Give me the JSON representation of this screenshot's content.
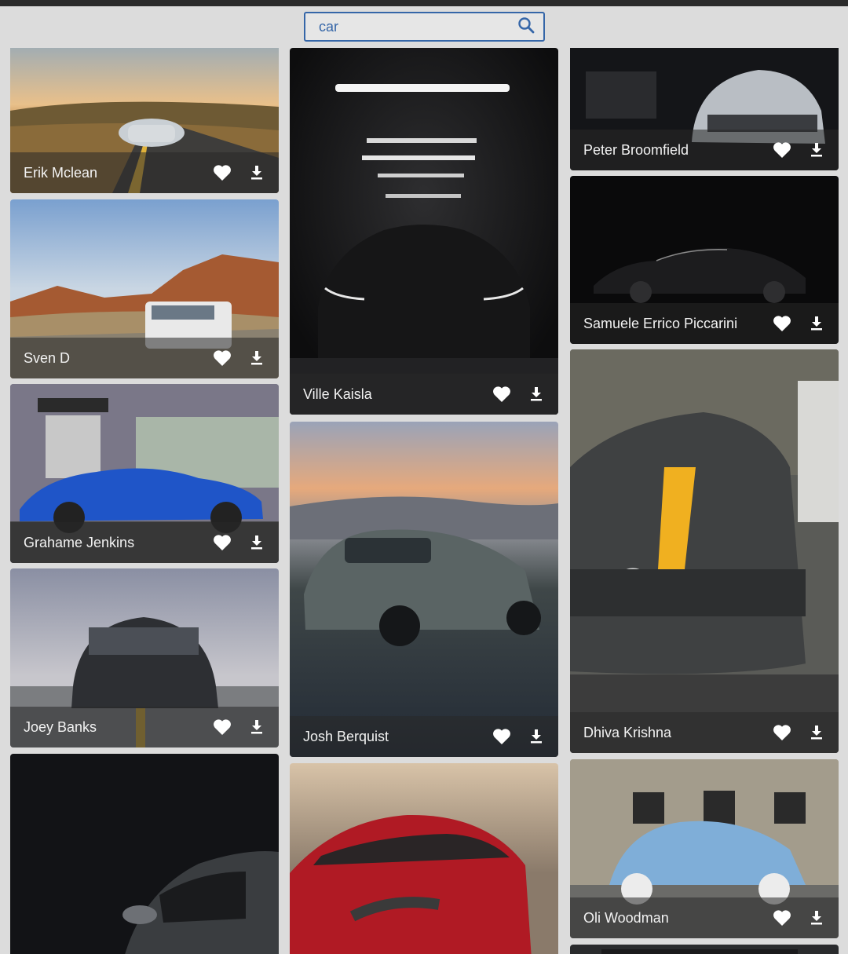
{
  "search": {
    "value": "car",
    "placeholder": ""
  },
  "cards": [
    {
      "author": "Erik Mclean"
    },
    {
      "author": "Sven D"
    },
    {
      "author": "Grahame Jenkins"
    },
    {
      "author": "Joey Banks"
    },
    {
      "author": "Ville Kaisla"
    },
    {
      "author": "Josh Berquist"
    },
    {
      "author": "Peter Broomfield"
    },
    {
      "author": "Samuele Errico Piccarini"
    },
    {
      "author": "Dhiva Krishna"
    },
    {
      "author": "Oli Woodman"
    }
  ],
  "icons": {
    "search": "search-icon",
    "like": "heart-icon",
    "download": "download-icon"
  },
  "colors": {
    "accent": "#3566a8",
    "background": "#dcdcdc"
  }
}
